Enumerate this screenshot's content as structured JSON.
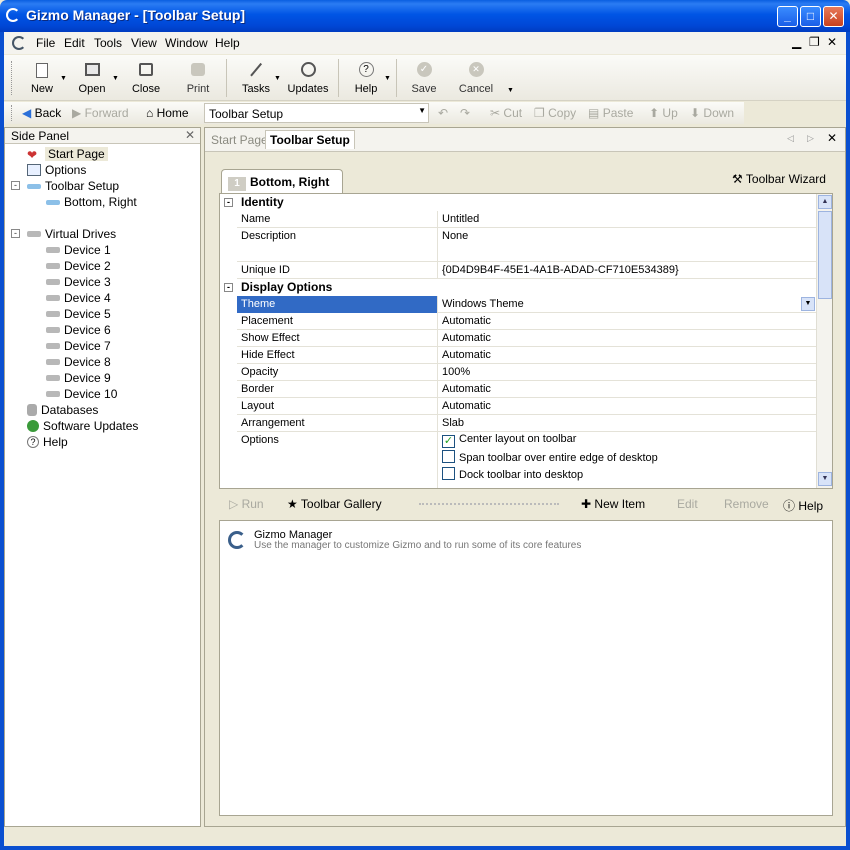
{
  "window": {
    "title": "Gizmo Manager - [Toolbar Setup]"
  },
  "menu": {
    "items": [
      "File",
      "Edit",
      "Tools",
      "View",
      "Window",
      "Help"
    ]
  },
  "toolbar": {
    "new": "New",
    "open": "Open",
    "close": "Close",
    "print": "Print",
    "tasks": "Tasks",
    "updates": "Updates",
    "help": "Help",
    "save": "Save",
    "cancel": "Cancel"
  },
  "nav": {
    "back": "Back",
    "forward": "Forward",
    "home": "Home",
    "location": "Toolbar Setup",
    "cut": "Cut",
    "copy": "Copy",
    "paste": "Paste",
    "up": "Up",
    "down": "Down"
  },
  "sidepanel": {
    "title": "Side Panel",
    "tree": [
      "Start Page",
      "Options",
      "Toolbar Setup",
      "Bottom, Right",
      "Virtual Drives",
      "Device 1",
      "Device 2",
      "Device 3",
      "Device 4",
      "Device 5",
      "Device 6",
      "Device 7",
      "Device 8",
      "Device 9",
      "Device 10",
      "Databases",
      "Software Updates",
      "Help"
    ]
  },
  "tabs": {
    "start_page": "Start Page",
    "toolbar_setup": "Toolbar Setup"
  },
  "editor": {
    "tab_number": "1",
    "tab_label": "Bottom, Right",
    "wizard": "Toolbar Wizard",
    "categories": {
      "identity": "Identity",
      "display": "Display Options"
    },
    "identity": [
      {
        "name": "Name",
        "value": "Untitled"
      },
      {
        "name": "Description",
        "value": "None"
      },
      {
        "name": "Unique ID",
        "value": "{0D4D9B4F-45E1-4A1B-ADAD-CF710E534389}"
      }
    ],
    "display": [
      {
        "name": "Theme",
        "value": "Windows Theme"
      },
      {
        "name": "Placement",
        "value": "Automatic"
      },
      {
        "name": "Show Effect",
        "value": "Automatic"
      },
      {
        "name": "Hide Effect",
        "value": "Automatic"
      },
      {
        "name": "Opacity",
        "value": "100%"
      },
      {
        "name": "Border",
        "value": "Automatic"
      },
      {
        "name": "Layout",
        "value": "Automatic"
      },
      {
        "name": "Arrangement",
        "value": "Slab"
      },
      {
        "name": "Options",
        "value": ""
      }
    ],
    "options": [
      {
        "label": "Center layout on toolbar",
        "checked": true
      },
      {
        "label": "Span toolbar over entire edge of desktop",
        "checked": false
      },
      {
        "label": "Dock toolbar into desktop",
        "checked": false
      }
    ]
  },
  "actions": {
    "run": "Run",
    "gallery": "Toolbar Gallery",
    "new_item": "New Item",
    "edit": "Edit",
    "remove": "Remove",
    "help": "Help"
  },
  "description": {
    "title": "Gizmo Manager",
    "text": "Use the manager to customize Gizmo and to run some of its core features"
  }
}
